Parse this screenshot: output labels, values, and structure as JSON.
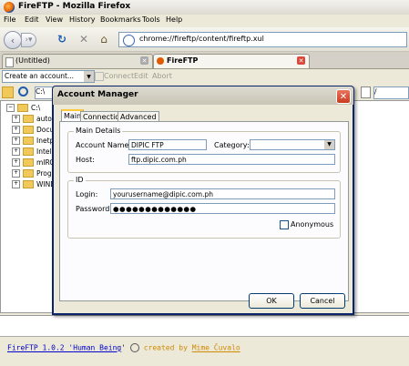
{
  "window": {
    "title": "FireFTP - Mozilla Firefox"
  },
  "menu": [
    "File",
    "Edit",
    "View",
    "History",
    "Bookmarks",
    "Tools",
    "Help"
  ],
  "nav": {
    "url": "chrome://fireftp/content/fireftp.xul"
  },
  "tabs": [
    {
      "label": "(Untitled)"
    },
    {
      "label": "FireFTP"
    }
  ],
  "toolbar": {
    "account_select": "Create an account...",
    "connect": "Connect",
    "edit": "Edit",
    "abort": "Abort"
  },
  "local": {
    "path": "C:\\",
    "tree": [
      {
        "label": "C:\\",
        "root": true
      },
      {
        "label": "autorun"
      },
      {
        "label": "Documents"
      },
      {
        "label": "Inetpub"
      },
      {
        "label": "Intel"
      },
      {
        "label": "mIRC"
      },
      {
        "label": "Program"
      },
      {
        "label": "WINDOWS"
      }
    ]
  },
  "remote": {
    "path": "/"
  },
  "dialog": {
    "title": "Account Manager",
    "tabs": [
      "Main",
      "Connection",
      "Advanced"
    ],
    "main_details": {
      "legend": "Main Details",
      "account_name_label": "Account Name:",
      "account_name": "DIPIC FTP",
      "category_label": "Category:",
      "category": "",
      "host_label": "Host:",
      "host": "ftp.dipic.com.ph"
    },
    "id": {
      "legend": "ID",
      "login_label": "Login:",
      "login": "yourusername@dipic.com.ph",
      "password_label": "Password:",
      "password": "●●●●●●●●●●●●●",
      "anonymous_label": "Anonymous"
    },
    "ok": "OK",
    "cancel": "Cancel"
  },
  "status": {
    "prefix": "FireFTP 1.0.2 '",
    "version_link": "Human Being",
    "mid": "'",
    "created_by": "created by",
    "author": "Mime Čuvalo"
  }
}
